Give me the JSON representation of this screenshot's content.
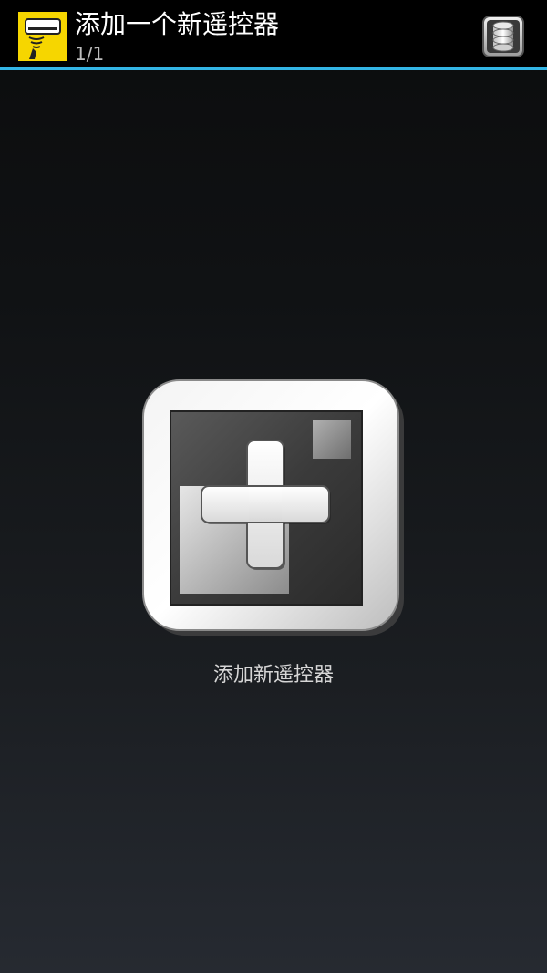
{
  "actionbar": {
    "title": "添加一个新遥控器",
    "subtitle": "1/1",
    "app_icon": "remote-control-app-icon",
    "action_icon": "database-icon",
    "accent_color": "#33b5e5",
    "icon_bg_color": "#f6d600"
  },
  "main": {
    "add_button_icon": "add-plus-icon",
    "add_label": "添加新遥控器"
  }
}
